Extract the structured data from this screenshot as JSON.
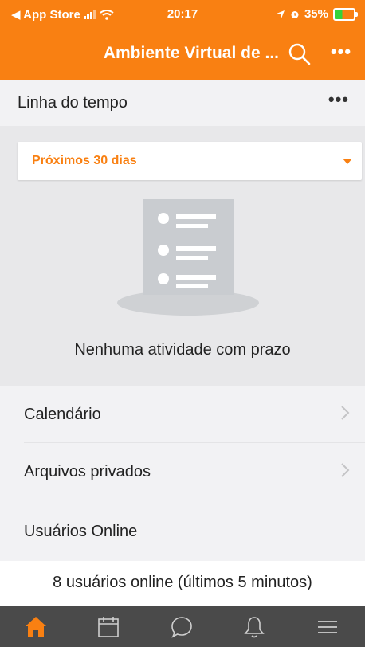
{
  "status_bar": {
    "back_app": "◀ App Store",
    "time": "20:17",
    "battery": "35%"
  },
  "header": {
    "title": "Ambiente Virtual de ...",
    "more": "•••"
  },
  "timeline": {
    "title": "Linha do tempo",
    "menu": "•••",
    "filter_value": "Próximos 30 dias",
    "empty_message": "Nenhuma atividade com prazo"
  },
  "links": [
    {
      "label": "Calendário"
    },
    {
      "label": "Arquivos privados"
    },
    {
      "label": "Usuários Online"
    }
  ],
  "online": {
    "text": "8 usuários online (últimos 5 minutos)"
  },
  "tabbar": {
    "active_color": "#f98012",
    "items": [
      "home-icon",
      "calendar-icon",
      "chat-icon",
      "bell-icon",
      "menu-icon"
    ]
  },
  "colors": {
    "accent": "#f98012",
    "tabbar": "#4a4a4a"
  }
}
